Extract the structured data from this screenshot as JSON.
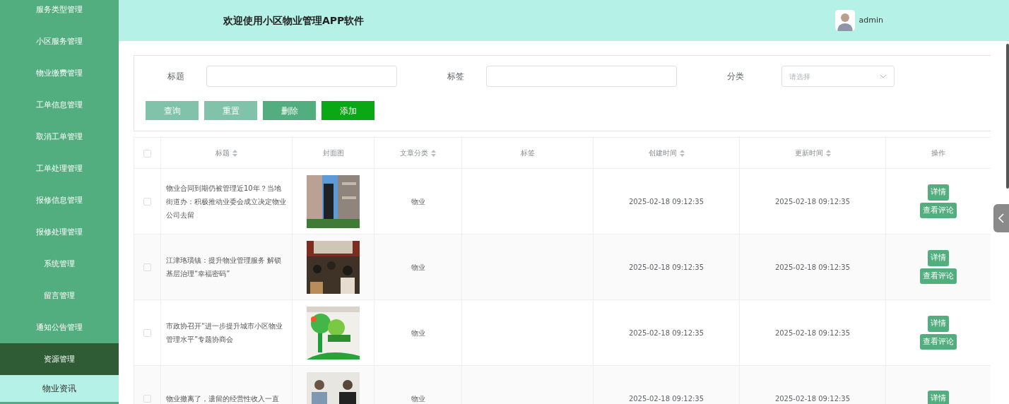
{
  "sidebar": {
    "items": [
      {
        "label": "服务类型管理",
        "expanded": false
      },
      {
        "label": "小区服务管理",
        "expanded": false
      },
      {
        "label": "物业缴费管理",
        "expanded": false
      },
      {
        "label": "工单信息管理",
        "expanded": false
      },
      {
        "label": "取消工单管理",
        "expanded": false
      },
      {
        "label": "工单处理管理",
        "expanded": false
      },
      {
        "label": "报修信息管理",
        "expanded": false
      },
      {
        "label": "报修处理管理",
        "expanded": false
      },
      {
        "label": "系统管理",
        "expanded": false
      },
      {
        "label": "留言管理",
        "expanded": false
      },
      {
        "label": "通知公告管理",
        "expanded": false
      },
      {
        "label": "资源管理",
        "expanded": true,
        "children": [
          {
            "label": "物业资讯",
            "selected": true
          }
        ]
      }
    ]
  },
  "header": {
    "title": "欢迎使用小区物业管理APP软件",
    "user": "admin"
  },
  "search": {
    "fields": [
      {
        "label": "标题",
        "kind": "text"
      },
      {
        "label": "标签",
        "kind": "text"
      },
      {
        "label": "分类",
        "kind": "select",
        "placeholder": "请选择"
      }
    ],
    "buttons": [
      {
        "label": "查询",
        "color": "#80c3aa"
      },
      {
        "label": "重置",
        "color": "#80c3aa"
      },
      {
        "label": "删除",
        "color": "#52ae7f"
      },
      {
        "label": "添加",
        "color": "#0aa815"
      }
    ]
  },
  "table": {
    "all_checked": false,
    "columns": [
      {
        "label": "标题",
        "sortable": true
      },
      {
        "label": "封面图",
        "sortable": false
      },
      {
        "label": "文章分类",
        "sortable": true
      },
      {
        "label": "标签",
        "sortable": false
      },
      {
        "label": "创建时间",
        "sortable": true
      },
      {
        "label": "更新时间",
        "sortable": true
      },
      {
        "label": "操作",
        "sortable": false
      }
    ],
    "rows": [
      {
        "checked": false,
        "title": "物业合同到期仍被管理近10年？当地街道办：积极推动业委会成立决定物业公司去留",
        "category": "物业",
        "created": "2025-02-18 09:12:35",
        "updated": "2025-02-18 09:12:35",
        "actions": [
          "详情",
          "查看评论"
        ]
      },
      {
        "checked": false,
        "title": "江津珞璜镇：提升物业管理服务 解锁基层治理“幸福密码”",
        "category": "物业",
        "created": "2025-02-18 09:12:35",
        "updated": "2025-02-18 09:12:35",
        "actions": [
          "详情",
          "查看评论"
        ]
      },
      {
        "checked": false,
        "title": "市政协召开“进一步提升城市小区物业管理水平”专题协商会",
        "category": "物业",
        "created": "2025-02-18 09:12:35",
        "updated": "2025-02-18 09:12:35",
        "actions": [
          "详情",
          "查看评论"
        ]
      },
      {
        "checked": false,
        "title": "物业撤离了，遗留的经营性收入一直",
        "category": "物业",
        "created": "2025-02-18 09:12:35",
        "updated": "2025-02-18 09:12:35",
        "actions": [
          "详情"
        ]
      }
    ]
  }
}
